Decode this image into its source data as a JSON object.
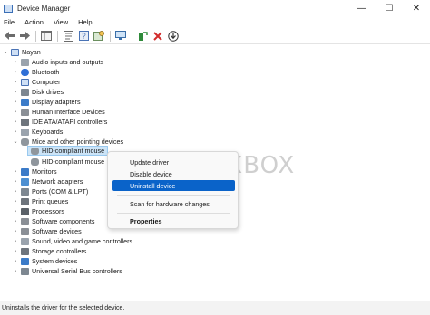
{
  "window": {
    "title": "Device Manager",
    "controls": {
      "minimize": "—",
      "maximize": "☐",
      "close": "✕"
    }
  },
  "menu": [
    "File",
    "Action",
    "View",
    "Help"
  ],
  "toolbar": [
    "back-arrow-icon",
    "forward-arrow-icon",
    "show-hide-tree-icon",
    "properties-icon",
    "help-icon",
    "driver-icon",
    "scan-hardware-icon",
    "enable-device-icon",
    "uninstall-device-icon",
    "update-driver-icon"
  ],
  "tree": {
    "root": "Nayan",
    "items": [
      {
        "label": "Audio inputs and outputs",
        "state": "collapsed",
        "icon": "audio-icon"
      },
      {
        "label": "Bluetooth",
        "state": "collapsed",
        "icon": "bluetooth-icon"
      },
      {
        "label": "Computer",
        "state": "collapsed",
        "icon": "computer-icon"
      },
      {
        "label": "Disk drives",
        "state": "collapsed",
        "icon": "disk-icon"
      },
      {
        "label": "Display adapters",
        "state": "collapsed",
        "icon": "display-icon"
      },
      {
        "label": "Human Interface Devices",
        "state": "collapsed",
        "icon": "hid-icon"
      },
      {
        "label": "IDE ATA/ATAPI controllers",
        "state": "collapsed",
        "icon": "ide-icon"
      },
      {
        "label": "Keyboards",
        "state": "collapsed",
        "icon": "keyboard-icon"
      },
      {
        "label": "Mice and other pointing devices",
        "state": "expanded",
        "icon": "mouse-icon"
      },
      {
        "label": "HID-compliant mouse",
        "state": "child-selected",
        "icon": "mouse-icon"
      },
      {
        "label": "HID-compliant mouse",
        "state": "child",
        "icon": "mouse-icon"
      },
      {
        "label": "Monitors",
        "state": "collapsed",
        "icon": "monitor-icon"
      },
      {
        "label": "Network adapters",
        "state": "collapsed",
        "icon": "network-icon"
      },
      {
        "label": "Ports (COM & LPT)",
        "state": "collapsed",
        "icon": "port-icon"
      },
      {
        "label": "Print queues",
        "state": "collapsed",
        "icon": "printer-icon"
      },
      {
        "label": "Processors",
        "state": "collapsed",
        "icon": "processor-icon"
      },
      {
        "label": "Software components",
        "state": "collapsed",
        "icon": "software-icon"
      },
      {
        "label": "Software devices",
        "state": "collapsed",
        "icon": "software-icon"
      },
      {
        "label": "Sound, video and game controllers",
        "state": "collapsed",
        "icon": "sound-icon"
      },
      {
        "label": "Storage controllers",
        "state": "collapsed",
        "icon": "storage-icon"
      },
      {
        "label": "System devices",
        "state": "collapsed",
        "icon": "system-icon"
      },
      {
        "label": "Universal Serial Bus controllers",
        "state": "collapsed",
        "icon": "usb-icon"
      }
    ]
  },
  "context_menu": {
    "update_driver": "Update driver",
    "disable_device": "Disable device",
    "uninstall_device": "Uninstall device",
    "scan_hardware": "Scan for hardware changes",
    "properties": "Properties"
  },
  "watermark": {
    "text": "WPXBOX"
  },
  "status": "Uninstalls the driver for the selected device.",
  "colors": {
    "accent": "#0a63c9",
    "selection": "#cce4f7"
  }
}
